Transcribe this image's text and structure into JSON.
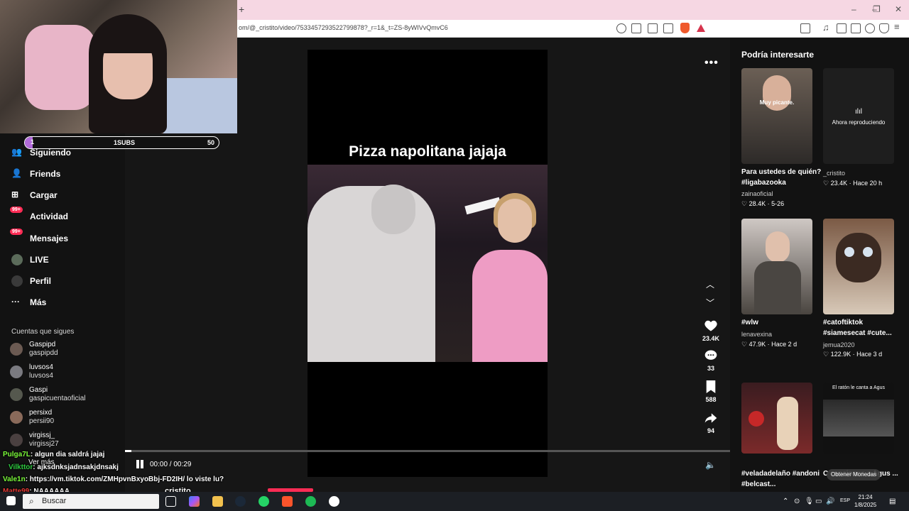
{
  "browser": {
    "new_tab": "+",
    "url": "om/@_cristito/video/7533457293522799878?_r=1&_t=ZS-8yWIVvQmvC6",
    "win_min": "–",
    "win_max": "❐",
    "win_close": "✕"
  },
  "sidebar": {
    "items": [
      {
        "label": "Siguiendo",
        "icon": "following-icon"
      },
      {
        "label": "Friends",
        "icon": "friends-icon"
      },
      {
        "label": "Cargar",
        "icon": "upload-icon"
      },
      {
        "label": "Actividad",
        "icon": "activity-icon",
        "badge": "99+"
      },
      {
        "label": "Mensajes",
        "icon": "messages-icon",
        "badge": "99+"
      },
      {
        "label": "LIVE",
        "icon": "live-icon"
      },
      {
        "label": "Perfil",
        "icon": "profile-icon"
      },
      {
        "label": "Más",
        "icon": "more-icon"
      }
    ],
    "following_title": "Cuentas que sigues",
    "accounts": [
      {
        "name": "Gaspipd",
        "handle": "gaspipdd"
      },
      {
        "name": "luvsos4",
        "handle": "luvsos4"
      },
      {
        "name": "Gaspi",
        "handle": "gaspicuentaoficial"
      },
      {
        "name": "persixd",
        "handle": "persii90"
      },
      {
        "name": "virgissj_",
        "handle": "virgissj27"
      }
    ],
    "ver_mas": "Ver más"
  },
  "stream_overlay": {
    "sub_count_left": "1",
    "sub_label": "1SUBS",
    "sub_count_right": "50",
    "sub_progress": 0.02
  },
  "chat": [
    {
      "user": "Pulga7L",
      "msg": ": algun dia saldrá jajaj",
      "color": "#7cfc3b"
    },
    {
      "user": "Vilkttor",
      "msg": ": ajksdnksjadnsakjdnsakj",
      "color": "#2ecc40"
    },
    {
      "user": "Vale1n",
      "msg": ": https://vm.tiktok.com/ZMHpvnBxyoBbj-FD2IH/ lo viste lu?",
      "color": "#7cfc3b"
    },
    {
      "user": "Matte99",
      "msg": ": NAAAAAA",
      "color": "#e53935"
    }
  ],
  "video": {
    "caption": "Pizza napolitana jajaja",
    "more": "•••",
    "likes": "23.4K",
    "comments": "33",
    "saves": "588",
    "shares": "94",
    "time": "00:00 / 00:29",
    "progress": 0.01,
    "author_partial": "cristito"
  },
  "suggestions": {
    "title": "Podría interesarte",
    "cards": [
      {
        "title": "Para ustedes de quién? #ligabazooka",
        "author": "zainaoficial",
        "likes": "♡ 28.4K",
        "date": "5-26",
        "overlay": "Muy picante."
      },
      {
        "title": "",
        "author": "_cristito",
        "likes": "♡ 23.4K",
        "date": "Hace 20 h",
        "overlay": "Ahora reproduciendo"
      },
      {
        "title": "#wlw",
        "author": "lenavexina",
        "likes": "♡ 47.9K",
        "date": "Hace 2 d",
        "overlay": ""
      },
      {
        "title": "#catoftiktok #siamesecat #cute...",
        "author": "jemua2020",
        "likes": "♡ 122.9K",
        "date": "Hace 3 d",
        "overlay": ""
      },
      {
        "title": "#veladadelaño #andoni #belcast...",
        "author": "",
        "likes": "",
        "date": "",
        "overlay": ""
      },
      {
        "title": "C canciones a Agus ...",
        "author": "",
        "likes": "",
        "date": "",
        "overlay": "El ratón le canta a Agus"
      }
    ],
    "coin_button": "Obtener Monedas"
  },
  "taskbar": {
    "search_placeholder": "Buscar",
    "time": "21:24",
    "date": "1/8/2025",
    "lang": "ESP"
  },
  "colors": {
    "accent": "#fe2c55",
    "tab_bg": "#f6d7e3"
  }
}
